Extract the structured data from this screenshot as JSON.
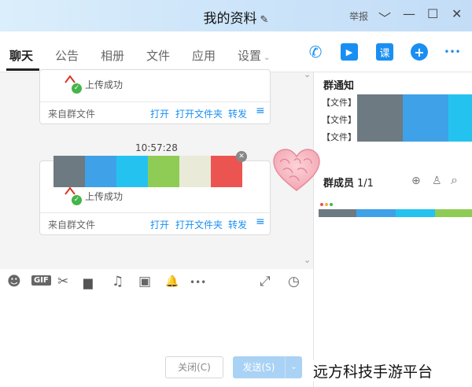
{
  "window": {
    "title": "我的资料",
    "report_label": "举报",
    "controls": [
      "﹀",
      "—",
      "☐",
      "✕"
    ]
  },
  "tabs": [
    {
      "label": "聊天",
      "active": true
    },
    {
      "label": "公告",
      "active": false
    },
    {
      "label": "相册",
      "active": false
    },
    {
      "label": "文件",
      "active": false
    },
    {
      "label": "应用",
      "active": false
    },
    {
      "label": "设置",
      "active": false,
      "caret": "⌄"
    }
  ],
  "tab_icons": [
    {
      "name": "phone-icon",
      "glyph": "✆"
    },
    {
      "name": "video-icon",
      "glyph": "▶"
    },
    {
      "name": "class-icon",
      "glyph": "课"
    },
    {
      "name": "add-app-icon",
      "glyph": "+"
    },
    {
      "name": "more-icon",
      "glyph": "•••"
    }
  ],
  "messages": [
    {
      "upload_status": "上传成功",
      "source": "来自群文件",
      "actions": [
        "打开",
        "打开文件夹",
        "转发"
      ],
      "menu_glyph": "≡"
    },
    {
      "timestamp": "10:57:28",
      "upload_status": "上传成功",
      "source": "来自群文件",
      "actions": [
        "打开",
        "打开文件夹",
        "转发"
      ],
      "menu_glyph": "≡",
      "close_glyph": "✕",
      "palette": [
        "#6e7a82",
        "#3fa1e8",
        "#24c3ef",
        "#8fcc55",
        "#e9ebd8",
        "#ec5451"
      ]
    }
  ],
  "collapse_glyph": "⌄",
  "toolbar": [
    {
      "name": "emoji-icon",
      "glyph": "☻"
    },
    {
      "name": "gif-icon",
      "glyph": "GIF"
    },
    {
      "name": "scissors-icon",
      "glyph": "✂"
    },
    {
      "name": "folder-icon",
      "glyph": "▆"
    },
    {
      "name": "music-icon",
      "glyph": "♫"
    },
    {
      "name": "image-icon",
      "glyph": "▣"
    },
    {
      "name": "bell-icon",
      "glyph": "🔔"
    },
    {
      "name": "more-tools-icon",
      "glyph": "•••"
    },
    {
      "name": "expand-icon",
      "glyph": "⤢"
    },
    {
      "name": "history-icon",
      "glyph": "◷"
    }
  ],
  "buttons": {
    "close_label": "关闭(C)",
    "send_label": "发送(S)",
    "send_caret": "⌄"
  },
  "right_panel": {
    "notice_title": "群通知",
    "notice_items": [
      "【文件】",
      "【文件】",
      "【文件】"
    ],
    "notice_palette": [
      "#6e7a82",
      "#3fa1e8",
      "#24c3ef"
    ],
    "members_title": "群成员",
    "members_count": "1/1",
    "member_icons": [
      {
        "name": "invite-icon",
        "glyph": "⊕"
      },
      {
        "name": "add-member-icon",
        "glyph": "♙"
      },
      {
        "name": "search-member-icon",
        "glyph": "⌕"
      }
    ],
    "member_palette": [
      "#6e7a82",
      "#3fa1e8",
      "#24c3ef",
      "#8fcc55"
    ],
    "dot_colors": [
      "#ec5451",
      "#f2b632",
      "#43b549"
    ]
  },
  "watermark": "远方科技手游平台",
  "colors": {
    "accent": "#1a8ff2",
    "success": "#43b549",
    "send_disabled": "#a9d2f5"
  }
}
